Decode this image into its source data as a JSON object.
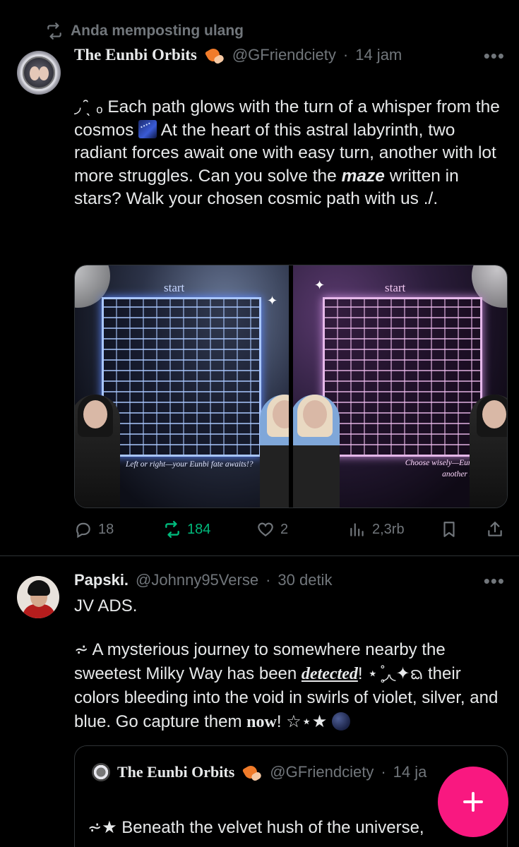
{
  "post1": {
    "repost_label": "Anda memposting ulang",
    "author": {
      "display_name": "The Eunbi Orbits",
      "handle": "@GFriendciety",
      "separator": "·",
      "time": "14 jam"
    },
    "text": {
      "line1_prefix": "◞ ̑̑ˎ ₒ Each path glows with the turn of a whisper from the cosmos",
      "line1_suffix": "At the heart of this astral labyrinth, two radiant forces await one with easy turn, another with lot more struggles. Can you solve the",
      "emphasis": "maze",
      "line_end": "written in stars? Walk your chosen cosmic path with us ./."
    },
    "media": {
      "left": {
        "start_label": "start",
        "caption": "Left or right—your Eunbi fate awaits!?"
      },
      "right": {
        "start_label": "start",
        "caption_line1": "Choose wisely—Eunbi or...",
        "caption_line2": "another Eunbi?"
      }
    },
    "actions": {
      "replies": "18",
      "reposts": "184",
      "likes": "2",
      "views": "2,3rb"
    },
    "colors": {
      "repost_active": "#00ba7c"
    }
  },
  "post2": {
    "author": {
      "display_name": "Papski.",
      "handle": "@Johnny95Verse",
      "separator": "·",
      "time": "30 detik"
    },
    "text": {
      "para1": "JV ADS.",
      "para2_a": "⩫ A mysterious journey to somewhere nearby the sweetest Milky Way has been",
      "para2_detected": "detected",
      "para2_b": "! ⋆  ̥̊◞◟✦ᨳ their colors bleeding into the void in swirls of violet, silver, and blue. Go capture them",
      "para2_now": "now",
      "para2_c": "! ☆⋆★"
    },
    "quote": {
      "display_name": "The Eunbi Orbits",
      "handle": "@GFriendciety",
      "separator": "·",
      "time": "14 ja",
      "text": "⩫★ Beneath the velvet hush of the universe,"
    }
  },
  "fab": {
    "icon": "plus-icon",
    "color": "#f91880"
  }
}
